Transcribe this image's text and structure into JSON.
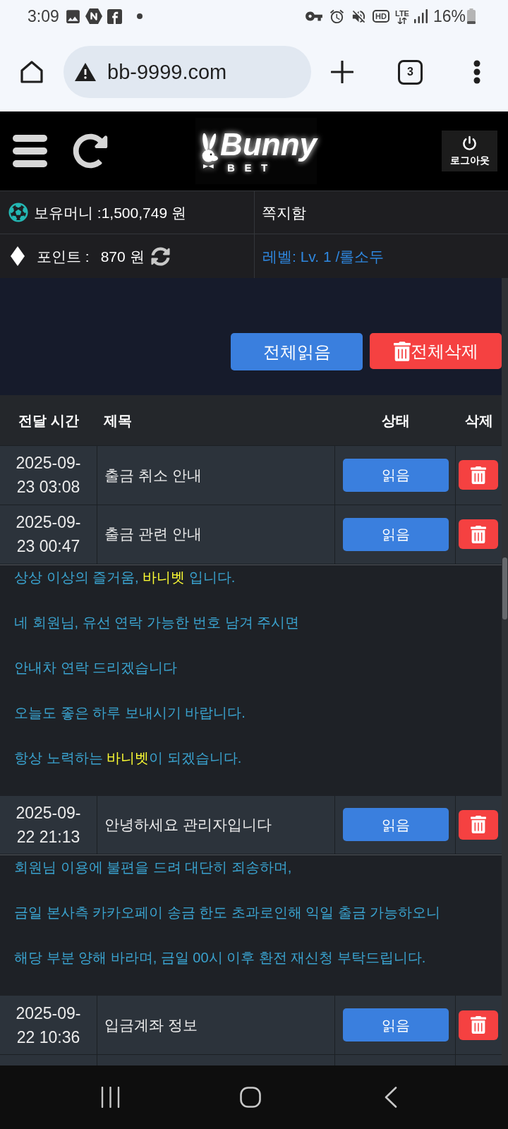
{
  "status_bar": {
    "time": "3:09",
    "indicators": [
      "HD",
      "LTE"
    ],
    "battery": "16%"
  },
  "browser": {
    "url": "bb-9999.com",
    "tab_count": "3"
  },
  "header": {
    "logo": {
      "name": "Bunny",
      "tag": "BET"
    },
    "logout": "로그아웃"
  },
  "account": {
    "balance": "보유머니 :1,500,749 원",
    "inbox": "쪽지함",
    "points_label": "포인트 :",
    "points_value": "870 원",
    "level": "레벨: Lv. 1 /롤소두"
  },
  "actions": [
    {
      "kind": "read_all",
      "label": "전체읽음"
    },
    {
      "kind": "delete_all",
      "label": "전체삭제"
    }
  ],
  "table": {
    "columns": [
      "전달 시간",
      "제목",
      "상태",
      "삭제"
    ],
    "rows": [
      {
        "sent": [
          "2025-09-",
          "23 03:08"
        ],
        "title": "출금 취소 안내",
        "status": "읽음"
      },
      {
        "sent": [
          "2025-09-",
          "23 00:47"
        ],
        "title": "출금 관련 안내",
        "status": "읽음",
        "message": [
          [
            {
              "text": "상상 이상의 즐거움, ",
              "highlight": false
            },
            {
              "text": "바니벳",
              "highlight": true
            },
            {
              "text": " 입니다.",
              "highlight": false
            }
          ],
          [
            {
              "text": "네 회원님, 유선 연락 가능한 번호 남겨 주시면",
              "highlight": false
            }
          ],
          [
            {
              "text": "안내차 연락 드리겠습니다",
              "highlight": false
            }
          ],
          [
            {
              "text": "오늘도 좋은 하루 보내시기 바랍니다.",
              "highlight": false
            }
          ],
          [
            {
              "text": "항상 노력하는 ",
              "highlight": false
            },
            {
              "text": "바니벳",
              "highlight": true
            },
            {
              "text": "이 되겠습니다.",
              "highlight": false
            }
          ]
        ]
      },
      {
        "sent": [
          "2025-09-",
          "22 21:13"
        ],
        "title": "안녕하세요 관리자입니다",
        "status": "읽음",
        "message": [
          [
            {
              "text": "회원님 이용에 불편을 드려 대단히 죄송하며,",
              "highlight": false
            }
          ],
          [
            {
              "text": "금일 본사측 카카오페이 송금 한도 초과로인해 익일 출금 가능하오니",
              "highlight": false
            }
          ],
          [
            {
              "text": "해당 부분 양해 바라며, 금일 00시 이후 환전 재신청 부탁드립니다.",
              "highlight": false
            }
          ]
        ]
      },
      {
        "sent": [
          "2025-09-",
          "22 10:36"
        ],
        "title": "입금계좌 정보",
        "status": "읽음"
      }
    ]
  }
}
